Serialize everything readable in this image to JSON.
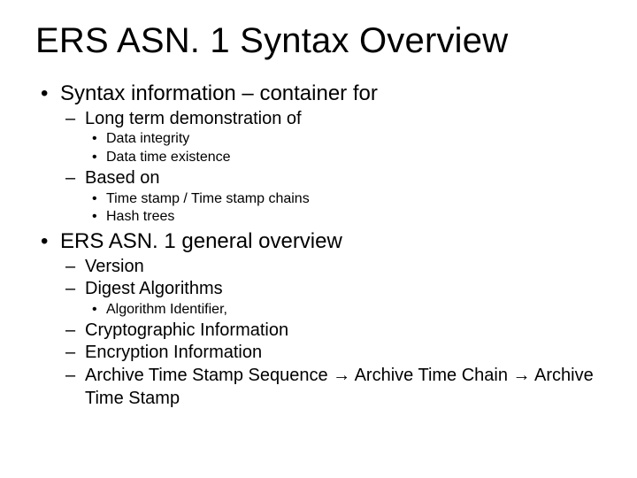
{
  "title": "ERS ASN. 1 Syntax Overview",
  "bullets": {
    "b1": "Syntax information – container for",
    "b1_1": "Long term demonstration of",
    "b1_1_1": "Data integrity",
    "b1_1_2": "Data time existence",
    "b1_2": "Based on",
    "b1_2_1": "Time stamp / Time stamp chains",
    "b1_2_2": "Hash trees",
    "b2": "ERS ASN. 1 general overview",
    "b2_1": "Version",
    "b2_2": "Digest Algorithms",
    "b2_2_1": "Algorithm Identifier,",
    "b2_3": "Cryptographic Information",
    "b2_4": "Encryption Information",
    "b2_5": "Archive Time Stamp Sequence → Archive Time Chain → Archive Time Stamp"
  }
}
